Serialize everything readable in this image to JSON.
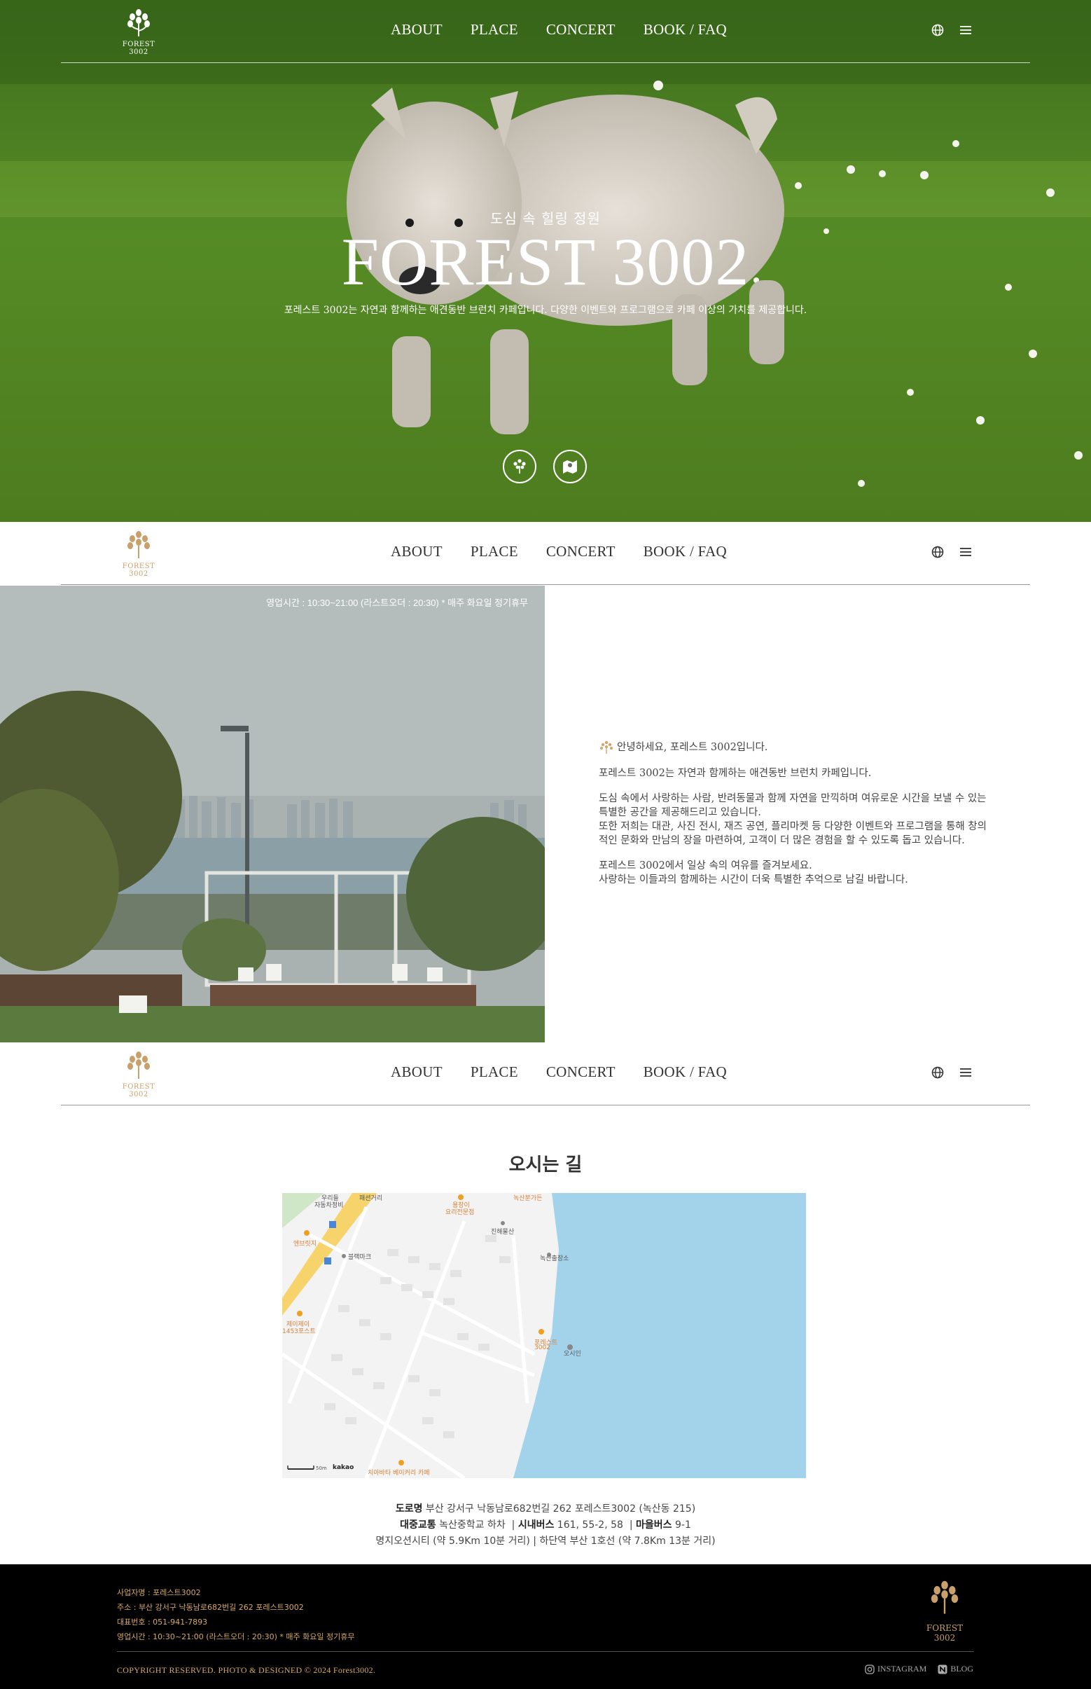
{
  "nav": {
    "logo_text": "FOREST 3002",
    "items": [
      "ABOUT",
      "PLACE",
      "CONCERT",
      "BOOK / FAQ"
    ],
    "icons": [
      "globe-icon",
      "menu-icon"
    ]
  },
  "hero": {
    "subtitle": "도심 속 힐링 정원",
    "title": "FOREST 3002",
    "description": "포레스트 3002는 자연과 함께하는 애견동반 브런치 카페입니다.  다양한 이벤트와 프로그램으로 카페 이상의 가치를 제공합니다.",
    "buttons": [
      "tree-icon",
      "map-icon"
    ]
  },
  "about": {
    "hours_overlay": "영업시간 : 10:30~21:00 (라스트오더 : 20:30)   * 매주 화요일 정기휴무",
    "greeting": "안녕하세요, 포레스트 3002입니다.",
    "p1": "포레스트 3002는 자연과 함께하는 애견동반 브런치 카페입니다.",
    "p2_l1": "도심 속에서 사랑하는 사람, 반려동물과 함께 자연을 만끽하며 여유로운 시간을 보낼 수 있는",
    "p2_l2": "특별한 공간을 제공해드리고 있습니다.",
    "p2_l3": "또한 저희는 대관, 사진 전시, 재즈 공연, 플리마켓 등 다양한 이벤트와 프로그램을 통해 창의",
    "p2_l4": "적인 문화와 만남의 장을 마련하여, 고객이 더 많은 경험을 할 수 있도록 돕고 있습니다.",
    "p3_l1": "포레스트 3002에서 일상 속의 여유를 즐겨보세요.",
    "p3_l2": "사랑하는 이들과의 함께하는 시간이 더욱 특별한 추억으로 남길 바랍니다."
  },
  "location": {
    "title": "오시는 길",
    "map_labels": {
      "l1": "우리들",
      "l1b": "자동차정비",
      "l2": "패션거리",
      "l3": "용장이",
      "l3b": "요리전문점",
      "l4": "녹산분가든",
      "l5": "진해물산",
      "l6": "엔브릿지",
      "l7": "블랙마크",
      "l8": "녹산출장소",
      "l9": "제이제이",
      "l9b": "1453포스트",
      "l10": "포레스트",
      "l10b": "3002",
      "l11": "오시인",
      "l12": "치아바타 베이커리 카페",
      "scale": "50m",
      "brand": "kakao"
    },
    "road_label": "도로명",
    "road": "부산 강서구 낙동남로682번길 262 포레스트3002 (녹산동 215)",
    "transit_label": "대중교통",
    "transit": "녹산중학교 하차",
    "city_bus_label": "시내버스",
    "city_bus": "161, 55-2, 58",
    "village_bus_label": "마을버스",
    "village_bus": "9-1",
    "line3": "명지오션시티 (약 5.9Km 10분 거리)  |  하단역 부산 1호선 (약 7.8Km 13분 거리)"
  },
  "footer": {
    "business": "사업자명 : 포레스트3002",
    "address": "주소 : 부산 강서구 낙동남로682번길 262 포레스트3002",
    "phone": "대표번호 : 051-941-7893",
    "hours": "영업시간 : 10:30~21:00 (라스트오더 : 20:30)   * 매주 화요일 정기휴무",
    "logo_text": "FOREST 3002",
    "copyright": "COPYRIGHT RESERVED. PHOTO & DESIGNED © 2024 Forest3002.",
    "instagram": "INSTAGRAM",
    "blog": "BLOG"
  },
  "colors": {
    "accent": "#c9a06a",
    "footer_bg": "#000000",
    "sea": "#a3d3ea"
  }
}
